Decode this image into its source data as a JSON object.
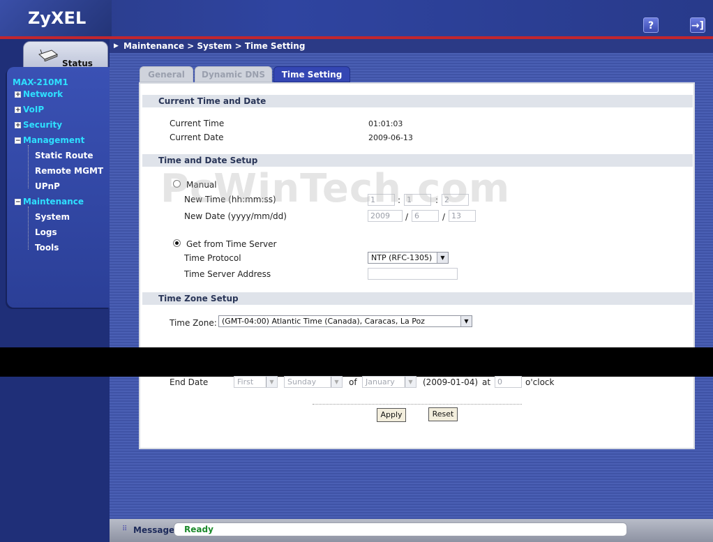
{
  "header": {
    "brand": "ZyXEL",
    "help_icon": "?",
    "logout_icon": "→]"
  },
  "breadcrumb": "Maintenance > System > Time Setting",
  "sidebar": {
    "status_label": "Status",
    "device": "MAX-210M1",
    "items": [
      {
        "label": "Network",
        "expander": "+"
      },
      {
        "label": "VoIP",
        "expander": "+"
      },
      {
        "label": "Security",
        "expander": "+"
      },
      {
        "label": "Management",
        "expander": "−"
      },
      {
        "label": "Static Route"
      },
      {
        "label": "Remote MGMT"
      },
      {
        "label": "UPnP"
      },
      {
        "label": "Maintenance",
        "expander": "−"
      },
      {
        "label": "System"
      },
      {
        "label": "Logs"
      },
      {
        "label": "Tools"
      }
    ]
  },
  "tabs": [
    {
      "label": "General",
      "active": false
    },
    {
      "label": "Dynamic DNS",
      "active": false
    },
    {
      "label": "Time Setting",
      "active": true
    }
  ],
  "current": {
    "header": "Current Time and Date",
    "time_label": "Current Time",
    "time_value": "01:01:03",
    "date_label": "Current Date",
    "date_value": "2009-06-13"
  },
  "setup": {
    "header": "Time and Date Setup",
    "manual_label": "Manual",
    "new_time_label": "New Time (hh:mm:ss)",
    "hh": "1",
    "mm": "1",
    "ss": "2",
    "time_sep": ":",
    "new_date_label": "New Date (yyyy/mm/dd)",
    "yyyy": "2009",
    "mon": "6",
    "dd": "13",
    "date_sep": "/",
    "server_label": "Get from Time Server",
    "protocol_label": "Time Protocol",
    "protocol_value": "NTP (RFC-1305)",
    "address_label": "Time Server Address",
    "address_value": ""
  },
  "zone": {
    "header": "Time Zone Setup",
    "zone_label": "Time Zone:",
    "zone_value": "(GMT-04:00) Atlantic Time (Canada), Caracas, La Poz",
    "end_label": "End Date",
    "end_week": "First",
    "end_day": "Sunday",
    "of_label": "of",
    "end_month": "January",
    "end_preview": "(2009-01-04)",
    "at_label": "at",
    "end_hour": "0",
    "oclock_label": "o'clock"
  },
  "buttons": {
    "apply": "Apply",
    "reset": "Reset"
  },
  "watermark": "PcWinTech.com",
  "footer": {
    "message_label": "Message",
    "message_value": "Ready"
  },
  "colors": {
    "accent_red": "#c2262e",
    "nav_top": "#2ee0ff",
    "ready_green": "#1d8a2c"
  }
}
